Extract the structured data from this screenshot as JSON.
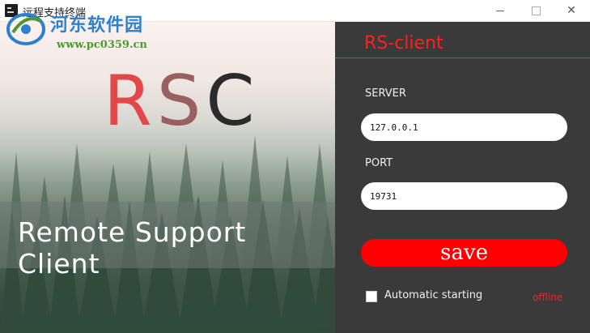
{
  "window": {
    "title": "远程支持终端",
    "minimize_symbol": "—",
    "maximize_symbol": "☐",
    "close_symbol": "✕"
  },
  "watermark": {
    "site_name": "河东软件园",
    "url": "www.pc0359.cn"
  },
  "left": {
    "logo_letters": [
      "R",
      "S",
      "C"
    ],
    "tagline": "Remote Support Client"
  },
  "right": {
    "title": "RS-client",
    "server_label": "SERVER",
    "server_value": "127.0.0.1",
    "port_label": "PORT",
    "port_value": "19731",
    "save_label": "save",
    "auto_start_label": "Automatic starting",
    "auto_start_checked": false,
    "status_text": "offline"
  },
  "colors": {
    "accent": "#ff0000",
    "panel_bg": "#3a3a3a"
  }
}
